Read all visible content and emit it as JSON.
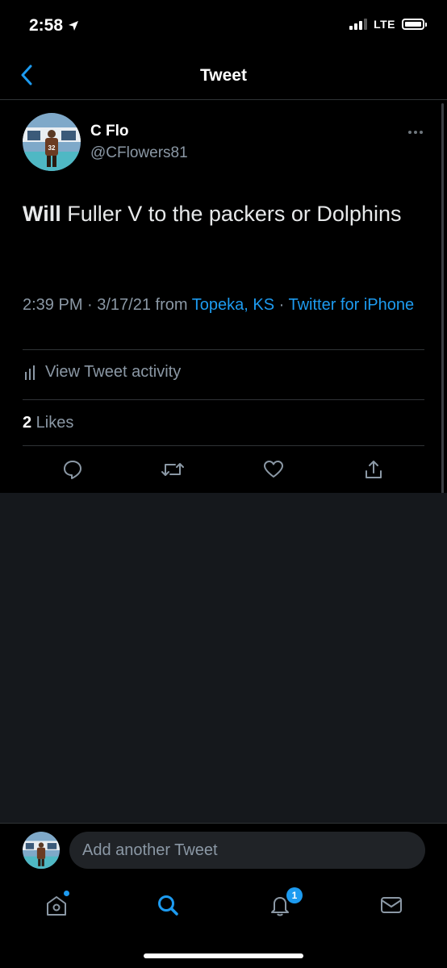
{
  "status": {
    "time": "2:58",
    "network": "LTE"
  },
  "nav": {
    "title": "Tweet"
  },
  "tweet": {
    "author_name": "C Flo",
    "author_handle": "@CFlowers81",
    "text_bold": "Will",
    "text_rest": " Fuller V to the packers or Dolphins",
    "time": "2:39 PM · 3/17/21 from ",
    "location": "Topeka, KS",
    "separator": " · ",
    "source": "Twitter for iPhone",
    "activity_label": "View Tweet activity",
    "likes_count": "2",
    "likes_label": " Likes"
  },
  "composer": {
    "placeholder": "Add another Tweet"
  },
  "tabbar": {
    "notifications_badge": "1"
  },
  "colors": {
    "accent": "#1d9bf0",
    "background": "#000000",
    "muted": "#8b98a5",
    "empty_area": "#15181c"
  }
}
